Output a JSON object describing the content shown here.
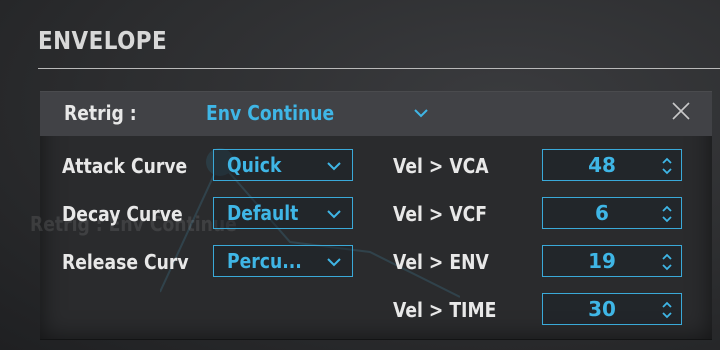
{
  "section": {
    "title": "ENVELOPE"
  },
  "retrig": {
    "label": "Retrig :",
    "value": "Env Continue"
  },
  "ghost_text": "Retrig : Env Continue",
  "curves": [
    {
      "label": "Attack Curve",
      "value": "Quick"
    },
    {
      "label": "Decay Curve",
      "value": "Default"
    },
    {
      "label": "Release Curv",
      "value": "Percu..."
    }
  ],
  "velocity": [
    {
      "label": "Vel > VCA",
      "value": "48"
    },
    {
      "label": "Vel > VCF",
      "value": "6"
    },
    {
      "label": "Vel > ENV",
      "value": "19"
    },
    {
      "label": "Vel > TIME",
      "value": "30"
    }
  ],
  "colors": {
    "accent": "#3fb6e6",
    "panel": "#2a2b2d",
    "header": "#414246"
  },
  "icons": {
    "close": "close-x-icon",
    "dropdown": "chevron-down-icon",
    "stepper": "up-down-arrows-icon"
  }
}
